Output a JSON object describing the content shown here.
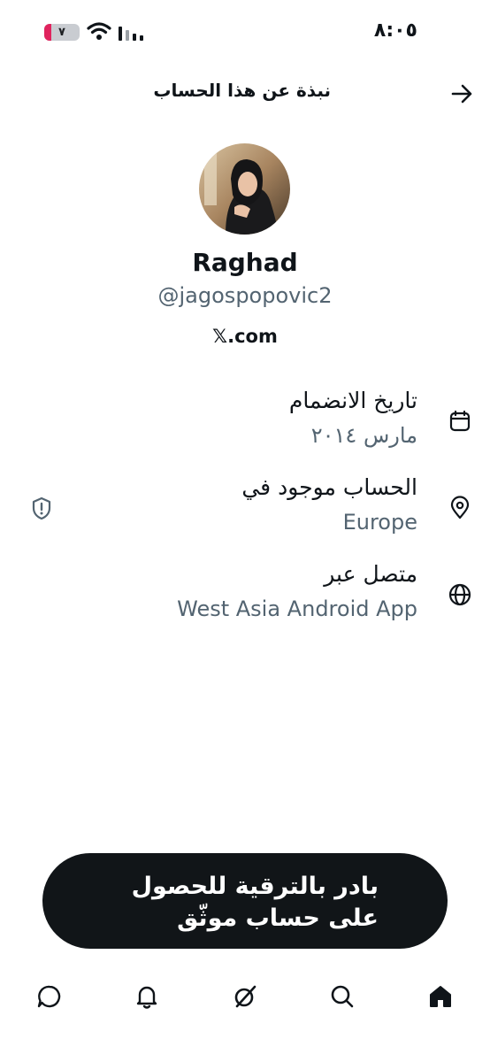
{
  "status_bar": {
    "time": "٨:٠٥",
    "battery_level": "٧"
  },
  "header": {
    "title": "نبذة عن هذا الحساب"
  },
  "profile": {
    "name": "Raghad",
    "handle": "@jagospopovic2",
    "site": "𝕏.com"
  },
  "info": [
    {
      "label": "تاريخ الانضمام",
      "value": "مارس ٢٠١٤",
      "icon": "calendar-icon"
    },
    {
      "label": "الحساب موجود في",
      "value": "Europe",
      "icon": "location-pin-icon"
    },
    {
      "label": "متصل عبر",
      "value": "West Asia Android App",
      "icon": "globe-icon"
    }
  ],
  "cta": {
    "text": "بادر بالترقية للحصول على حساب موثّق"
  },
  "colors": {
    "text_primary": "#0f1419",
    "text_secondary": "#536471",
    "cta_background": "#111518"
  },
  "bottom_nav": {
    "items": [
      "home-icon",
      "search-icon",
      "grok-icon",
      "notifications-icon",
      "messages-icon"
    ]
  }
}
